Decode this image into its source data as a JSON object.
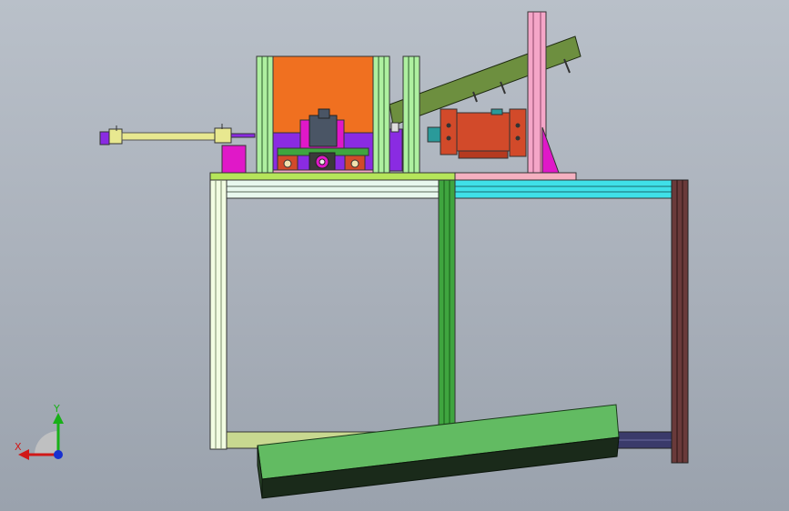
{
  "viewport": {
    "background_top": "#b9c0c9",
    "background_bottom": "#9aa2ad"
  },
  "triad": {
    "x_label": "X",
    "y_label": "Y",
    "x_color": "#d01818",
    "y_color": "#18b018",
    "z_color": "#1830d0"
  },
  "model": {
    "colors": {
      "frame_left": "#f2fde2",
      "frame_mid": "#3fa53f",
      "frame_right": "#6a3a3a",
      "top_beam_cyan": "#3fe0e8",
      "top_plate": "#b5e55a",
      "hopper_orange": "#f07020",
      "pillar_green": "#aef0a0",
      "motor_red": "#d24a2a",
      "chute_olive": "#6d8f3f",
      "pink_post": "#f5a6c8",
      "magenta": "#e018c8",
      "purple_block": "#8a2be2",
      "cylinder_yellow": "#e8e890",
      "floor_board": "#62bb62"
    }
  }
}
